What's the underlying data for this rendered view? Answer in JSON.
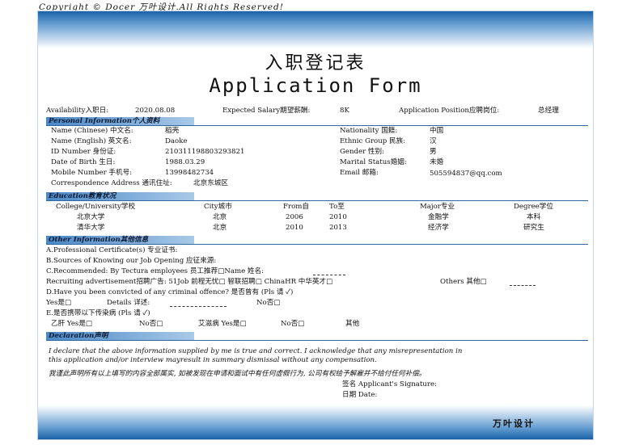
{
  "copyright": "Copyright © Docer 万叶设计.All Rights Reserved!",
  "title_cn": "入职登记表",
  "title_en": "Application Form",
  "top": {
    "availability_label": "Availability入职日:",
    "availability": "2020.08.08",
    "salary_label": "Expected Salary期望薪酬:",
    "salary": "8K",
    "position_label": "Application Position应聘岗位:",
    "position": "总经理"
  },
  "personal": {
    "heading": "Personal Information个人资料",
    "left": [
      {
        "label": "Name (Chinese) 中文名:",
        "value": "稻壳"
      },
      {
        "label": "Name (English) 英文名:",
        "value": "Daoke"
      },
      {
        "label": "ID Number 身份证:",
        "value": "210311198803293821"
      },
      {
        "label": "Date of Birth 生日:",
        "value": "1988.03.29"
      },
      {
        "label": "Mobile Number 手机号:",
        "value": "13998482734"
      }
    ],
    "address_label": "Correspondence Address 通讯住址:",
    "address": "北京东城区",
    "right": [
      {
        "label": "Nationality 国籍:",
        "value": "中国"
      },
      {
        "label": "Ethnic Group 民族:",
        "value": "汉"
      },
      {
        "label": "Gender 性别:",
        "value": "男"
      },
      {
        "label": "Marital Status婚姻:",
        "value": "未婚"
      },
      {
        "label": "Email 邮箱:",
        "value": "505594837@qq.com"
      }
    ]
  },
  "education": {
    "heading": "Education教育状况",
    "headers": [
      "College/University学校",
      "City城市",
      "From自",
      "To至",
      "Major专业",
      "Degree学位"
    ],
    "rows": [
      [
        "北京大学",
        "北京",
        "2006",
        "2010",
        "金融学",
        "本科"
      ],
      [
        "清华大学",
        "北京",
        "2010",
        "2013",
        "经济学",
        "研究生"
      ]
    ]
  },
  "other": {
    "heading": "Other Information其他信息",
    "a": "A.Professional Certificate(s) 专业证书:",
    "b": "B.Sources of Knowing our Job Opening 应征来源:",
    "c": "C.Recommended: By Tectura employees 员工推荐□Name 姓名:",
    "recruit": "Recruiting advertisement招聘广告: 51Job 前程无忧□  智联招聘□  ChinaHR 中华英才□",
    "recruit_others": "Others 其他□",
    "d": "D.Have you been convicted of any criminal offence? 是否曾有 (Pls 请 ✓)",
    "yes": "Yes是□",
    "details": "Details 详述:",
    "no": "No否□",
    "e": "E.是否携带以下传染病 (Pls 请 ✓)",
    "hep_yes": "乙肝 Yes是□",
    "hep_no": "No否□",
    "aids_yes": "艾滋病 Yes是□",
    "aids_no": "No否□",
    "other_disease": "其他"
  },
  "declaration": {
    "heading": "Declaration声明",
    "en1": "I declare that the above information supplied by me is true and correct.  I acknowledge that any misrepresentation in",
    "en2": "this application and/or interview mayresult in summary dismissal without any compensation.",
    "cn": "我谨此声明所有以上填写的内容全部属实, 如被发现在申请和面试中有任何虚假行为, 公司有权给予解雇并不给付任何补偿。",
    "sign": "签名  Applicant's Signature:",
    "date": "日期  Date:"
  },
  "footer_brand": "万叶设计"
}
